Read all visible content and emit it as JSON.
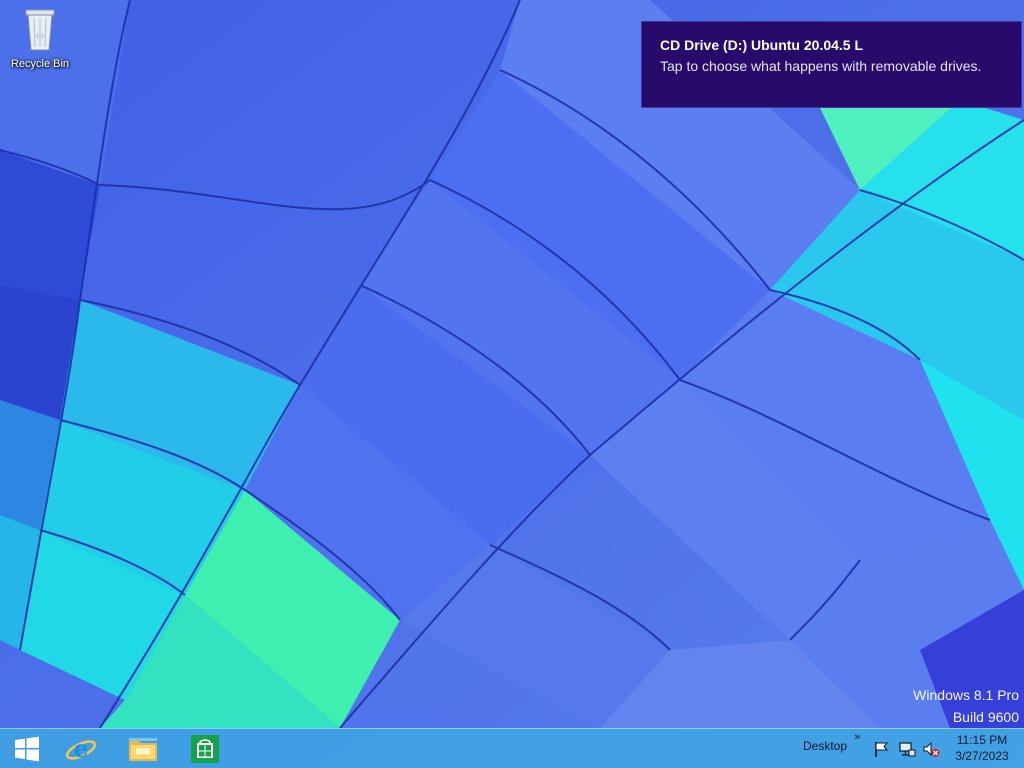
{
  "desktop": {
    "icons": [
      {
        "label": "Recycle Bin",
        "icon": "recycle-bin-icon"
      }
    ]
  },
  "notification": {
    "title": "CD Drive (D:) Ubuntu 20.04.5 L",
    "message": "Tap to choose what happens with removable drives."
  },
  "watermark": {
    "line1": "Windows 8.1 Pro",
    "line2": "Build 9600"
  },
  "taskbar": {
    "pinned": [
      "windows-start-icon",
      "internet-explorer-icon",
      "file-explorer-icon",
      "store-icon"
    ],
    "toolbar_label": "Desktop",
    "toolbar_chevron": "»",
    "tray": [
      "action-center-flag-icon",
      "network-icon",
      "volume-muted-icon"
    ],
    "time": "11:15 PM",
    "date": "3/27/2023"
  },
  "colors": {
    "toast_bg": "#280a6b",
    "taskbar_bg": "#3caae1",
    "wallpaper_blue": "#4a6be8",
    "wallpaper_cyan": "#25d8e8",
    "wallpaper_green": "#3ff0a8"
  }
}
